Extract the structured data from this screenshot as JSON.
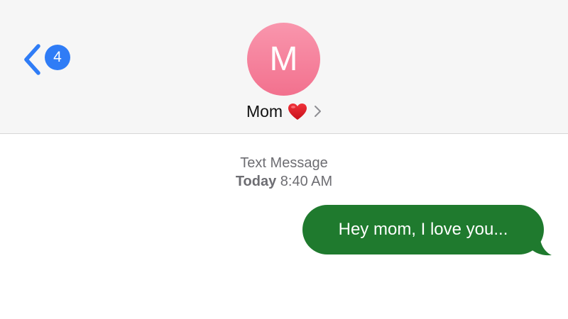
{
  "header": {
    "back_badge": "4",
    "avatar_initial": "M",
    "contact_name": "Mom",
    "contact_emoji": "heart-icon",
    "accent_color": "#2f7cf6",
    "avatar_color": "#f4809b"
  },
  "conversation": {
    "service_label": "Text Message",
    "day_label": "Today",
    "time_label": "8:40 AM"
  },
  "messages": [
    {
      "text": "Hey mom, I love you...",
      "sender": "me",
      "bubble_color": "#1f7a2e"
    }
  ]
}
